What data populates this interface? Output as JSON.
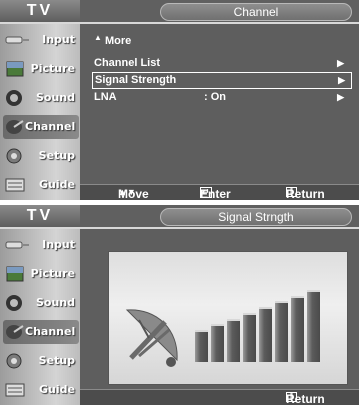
{
  "screen1": {
    "tv_label": "TV",
    "header_title": "Channel",
    "sidebar": [
      "Input",
      "Picture",
      "Sound",
      "Channel",
      "Setup",
      "Guide"
    ],
    "active_item": "Channel",
    "menu": {
      "more": "More",
      "items": [
        {
          "label": "Channel List",
          "value": ""
        },
        {
          "label": "Signal Strength",
          "value": ""
        },
        {
          "label": "LNA",
          "value": ": On"
        }
      ],
      "selected_index": 1
    },
    "footer": {
      "move": "Move",
      "enter": "Enter",
      "return": "Return"
    }
  },
  "screen2": {
    "tv_label": "TV",
    "header_title": "Signal Strngth",
    "sidebar": [
      "Input",
      "Picture",
      "Sound",
      "Channel",
      "Setup",
      "Guide"
    ],
    "active_item": "Channel",
    "signal": {
      "bars_total": 8,
      "bars_lit": 8
    },
    "footer": {
      "return": "Return"
    }
  },
  "colors": {
    "panel_bg": "#5e5e5e",
    "sidebar_bg": "#c8c8c8",
    "bar": "#4a4a4a"
  }
}
